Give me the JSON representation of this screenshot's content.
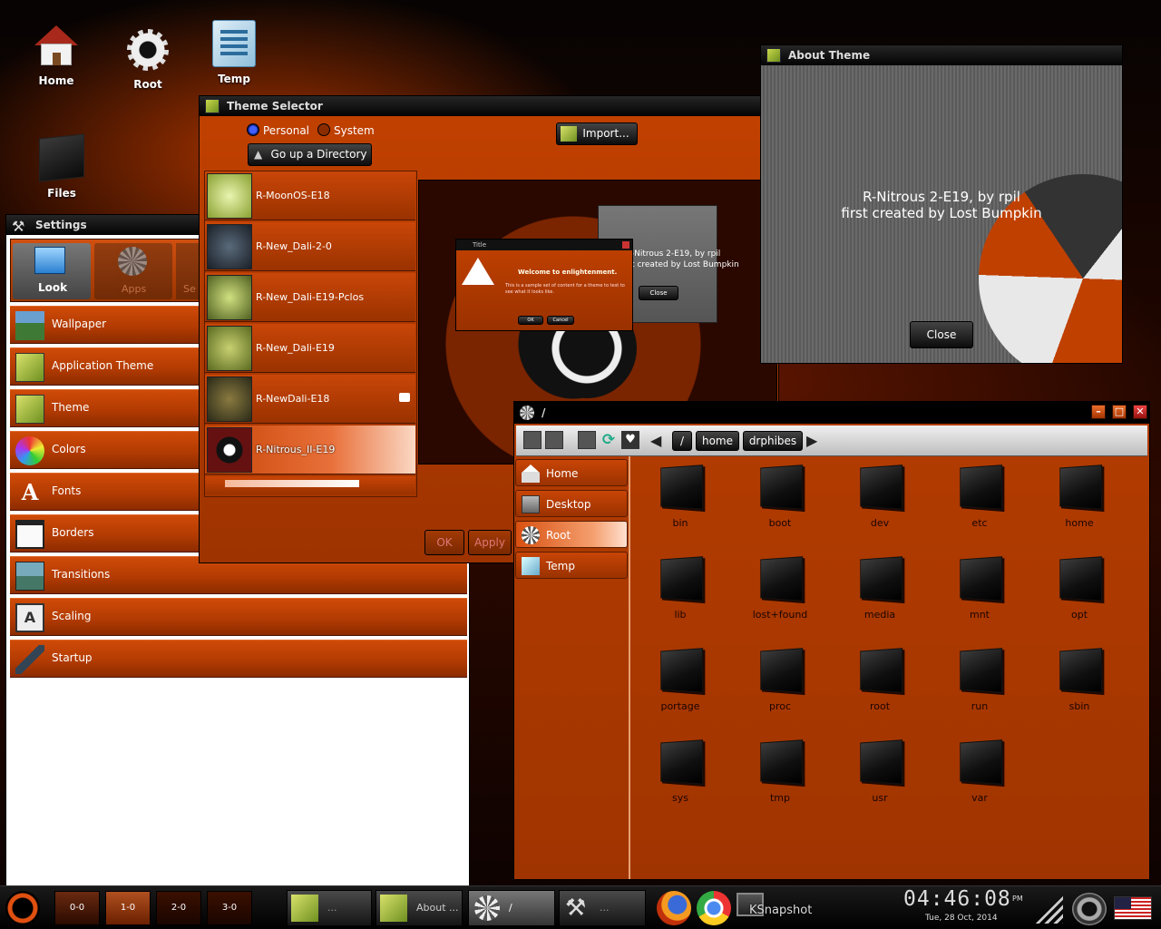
{
  "desktop": {
    "icons": [
      {
        "label": "Home"
      },
      {
        "label": "Root"
      },
      {
        "label": "Temp"
      },
      {
        "label": "Files"
      }
    ]
  },
  "theme_selector": {
    "title": "Theme Selector",
    "radio_personal": "Personal",
    "radio_system": "System",
    "up_button": "Go up a Directory",
    "import_button": "Import...",
    "themes": [
      "R-MoonOS-E18",
      "R-New_Dali-2-0",
      "R-New_Dali-E19-Pclos",
      "R-New_Dali-E19",
      "R-NewDali-E18",
      "R-Nitrous_II-E19"
    ],
    "ok_button": "OK",
    "apply_button": "Apply",
    "preview": {
      "dialog_title": "Title",
      "dialog_heading": "Welcome to enlightenment.",
      "dialog_body": "This is a sample set of content for a theme to test to see what it looks like.",
      "dialog_ok": "OK",
      "dialog_cancel": "Cancel",
      "about_text_1": "R-Nitrous 2-E19, by rpil",
      "about_text_2": "first created by Lost Bumpkin",
      "about_close": "Close"
    }
  },
  "about_theme": {
    "title": "About Theme",
    "line1": "R-Nitrous 2-E19, by rpil",
    "line2": "first created by Lost Bumpkin",
    "close_button": "Close"
  },
  "settings": {
    "title": "Settings",
    "tabs": [
      "Look",
      "Apps",
      "Se"
    ],
    "items": [
      "Wallpaper",
      "Application Theme",
      "Theme",
      "Colors",
      "Fonts",
      "Borders",
      "Transitions",
      "Scaling",
      "Startup"
    ]
  },
  "file_manager": {
    "title": "/",
    "path": [
      "/",
      "home",
      "drphibes"
    ],
    "sidebar": [
      "Home",
      "Desktop",
      "Root",
      "Temp"
    ],
    "folders": [
      "bin",
      "boot",
      "dev",
      "etc",
      "home",
      "lib",
      "lost+found",
      "media",
      "mnt",
      "opt",
      "portage",
      "proc",
      "root",
      "run",
      "sbin",
      "sys",
      "tmp",
      "usr",
      "var"
    ]
  },
  "taskbar": {
    "pager": [
      "0-0",
      "1-0",
      "2-0",
      "3-0"
    ],
    "tasks": [
      "...",
      "About ...",
      "/",
      "..."
    ],
    "ksnapshot": "KSnapshot",
    "clock": "04:46:08",
    "clock_ampm": "PM",
    "date": "Tue, 28 Oct, 2014"
  },
  "colors": {
    "accent": "#c24100",
    "titlebar": "#0a0a0a",
    "fm_bg": "#b03a00"
  }
}
